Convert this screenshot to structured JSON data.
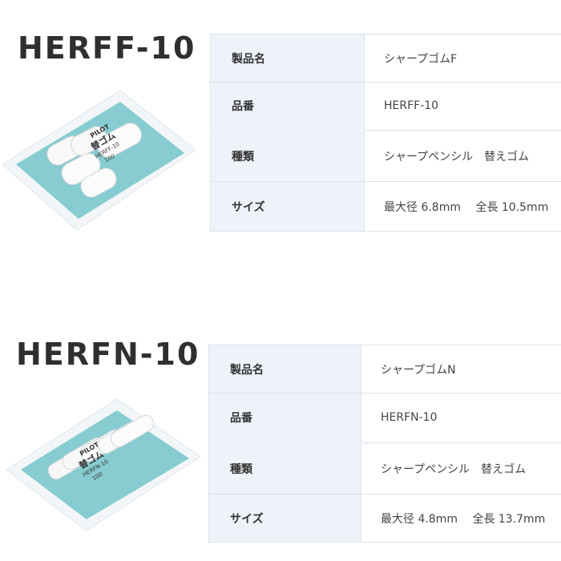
{
  "products": [
    {
      "model": "HERFF-10",
      "package_text": [
        "PILOT",
        "替ゴム",
        "HERFF-10",
        "100"
      ],
      "specs": [
        {
          "label": "製品名",
          "value": "シャープゴムF"
        },
        {
          "label": "品番",
          "value": "HERFF-10"
        },
        {
          "label": "種類",
          "value": "シャープペンシル　替えゴム"
        },
        {
          "label": "サイズ",
          "value": "最大径 6.8mm　 全長 10.5mm"
        }
      ]
    },
    {
      "model": "HERFN-10",
      "package_text": [
        "PILOT",
        "替ゴム",
        "HERFN-10",
        "100"
      ],
      "specs": [
        {
          "label": "製品名",
          "value": "シャープゴムN"
        },
        {
          "label": "品番",
          "value": "HERFN-10"
        },
        {
          "label": "種類",
          "value": "シャープペンシル　替えゴム"
        },
        {
          "label": "サイズ",
          "value": "最大径 4.8mm　 全長 13.7mm"
        }
      ]
    }
  ],
  "colors": {
    "label_bg": "#eef3f9",
    "border": "#dde3ea",
    "package_teal": "#86ccd0",
    "title": "#2f2f2f"
  }
}
